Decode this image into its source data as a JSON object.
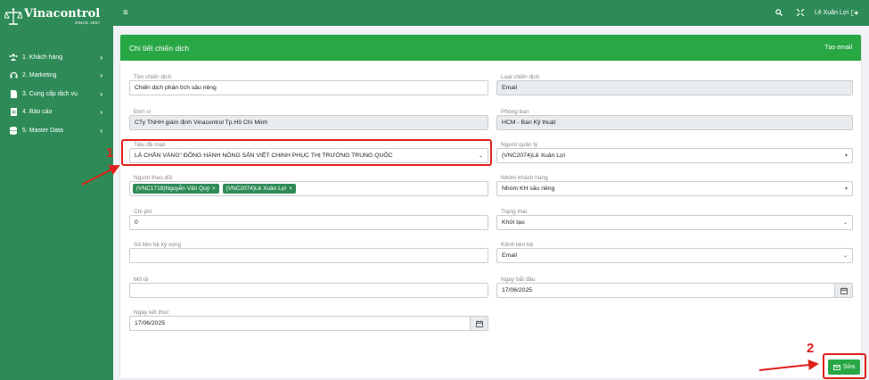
{
  "brand": {
    "name": "Vinacontrol",
    "tagline": "SINCE 1957"
  },
  "sidebar": {
    "items": [
      {
        "label": "1. Khách hàng",
        "icon": "users-icon"
      },
      {
        "label": "2. Marketing",
        "icon": "headset-icon"
      },
      {
        "label": "3. Cung cấp dịch vụ",
        "icon": "document-icon"
      },
      {
        "label": "4. Báo cáo",
        "icon": "report-icon"
      },
      {
        "label": "5. Master Data",
        "icon": "database-icon"
      }
    ]
  },
  "topbar": {
    "menu_icon": "hamburger-icon",
    "user_name": "Lê Xuân Lợi"
  },
  "card": {
    "title": "Chi tiết chiến dịch",
    "action_label": "Tạo email"
  },
  "form": {
    "campaign_name": {
      "label": "Tên chiến dịch",
      "value": "Chiến dịch phân tích sầu riêng"
    },
    "campaign_type": {
      "label": "Loại chiến dịch",
      "value": "Email"
    },
    "unit": {
      "label": "Đơn vị",
      "value": "CTy TNHH giám định Vinacontrol Tp.Hồ Chí Minh"
    },
    "department": {
      "label": "Phòng ban",
      "value": "HCM - Ban Kỹ thuật"
    },
    "email_subject": {
      "label": "Tiêu đề mail",
      "value": "LÁ CHẮN VÀNG\" ĐỒNG HÀNH NÔNG SẢN VIỆT CHINH PHỤC THỊ TRƯỜNG TRUNG QUỐC"
    },
    "manager": {
      "label": "Người quản lý",
      "value": "(VNC2074)Lê Xuân Lợi"
    },
    "followers": {
      "label": "Người theo dõi",
      "tags": [
        "(VNC1718)Nguyễn Văn Quý",
        "(VNC2074)Lê Xuân Lợi"
      ]
    },
    "customer_group": {
      "label": "Nhóm khách hàng",
      "value": "Nhóm KH sầu riêng"
    },
    "cost": {
      "label": "Chi phí",
      "value": "0"
    },
    "status": {
      "label": "Trạng thái",
      "value": "Khởi tạo"
    },
    "expected_contacts": {
      "label": "Số liên hệ kỳ vọng",
      "value": ""
    },
    "contact_channel": {
      "label": "Kênh liên hệ",
      "value": "Email"
    },
    "description": {
      "label": "Mô tả",
      "value": ""
    },
    "start_date": {
      "label": "Ngày bắt đầu",
      "value": "17/06/2025"
    },
    "end_date": {
      "label": "Ngày kết thúc",
      "value": "17/06/2025"
    }
  },
  "edit_button": {
    "label": "Sửa"
  },
  "annotations": {
    "marker_1": "1",
    "marker_2": "2",
    "color": "#e0201b"
  },
  "colors": {
    "sidebar": "#2e8b57",
    "header": "#28a745"
  }
}
